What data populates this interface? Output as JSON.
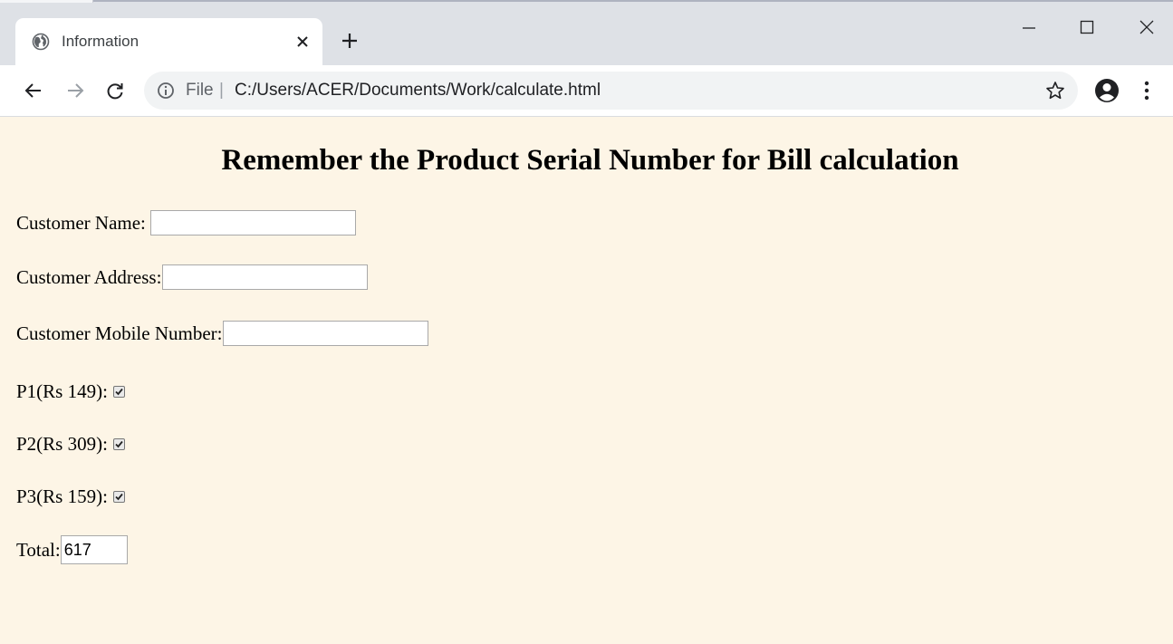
{
  "browser": {
    "tab_title": "Information",
    "omnibox": {
      "scheme_label": "File",
      "separator": "|",
      "url": "C:/Users/ACER/Documents/Work/calculate.html"
    },
    "icons": {
      "tab": "globe-icon",
      "new_tab": "plus-icon",
      "back": "arrow-left-icon",
      "forward": "arrow-right-icon",
      "reload": "reload-icon",
      "info": "info-icon",
      "bookmark": "star-icon",
      "profile": "account-icon",
      "menu": "kebab-menu-icon"
    }
  },
  "page": {
    "heading": "Remember the Product Serial Number for Bill calculation",
    "background_color": "#fdf5e6",
    "fields": {
      "name_label": "Customer Name:",
      "name_value": "",
      "address_label": "Customer Address:",
      "address_value": "",
      "mobile_label": "Customer Mobile Number:",
      "mobile_value": ""
    },
    "products": [
      {
        "label": "P1(Rs 149):",
        "checked": true
      },
      {
        "label": "P2(Rs 309):",
        "checked": true
      },
      {
        "label": "P3(Rs 159):",
        "checked": true
      }
    ],
    "total_label": "Total:",
    "total_value": "617"
  }
}
